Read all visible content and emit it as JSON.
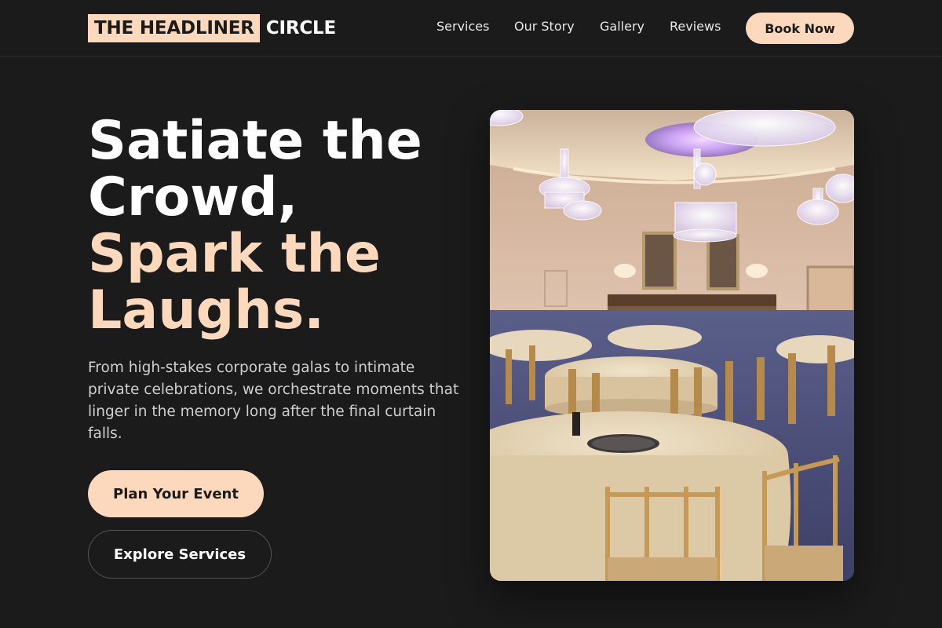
{
  "header": {
    "logo_highlight": "THE HEADLINER",
    "logo_text": "CIRCLE",
    "nav": [
      "Services",
      "Our Story",
      "Gallery",
      "Reviews"
    ],
    "cta_label": "Book Now"
  },
  "hero": {
    "headline_lines": [
      "Satiate the",
      "Crowd,"
    ],
    "headline_accent_lines": [
      "Spark the",
      "Laughs."
    ],
    "description": "From high-stakes corporate galas to intimate private celebrations, we orchestrate moments that linger in the memory long after the final curtain falls.",
    "primary_button": "Plan Your Event",
    "secondary_button": "Explore Services"
  },
  "colors": {
    "background": "#1b1b1b",
    "accent": "#fcd9bc",
    "text": "#ffffff"
  },
  "image": {
    "icon_name": "banquet-hall-photo"
  }
}
